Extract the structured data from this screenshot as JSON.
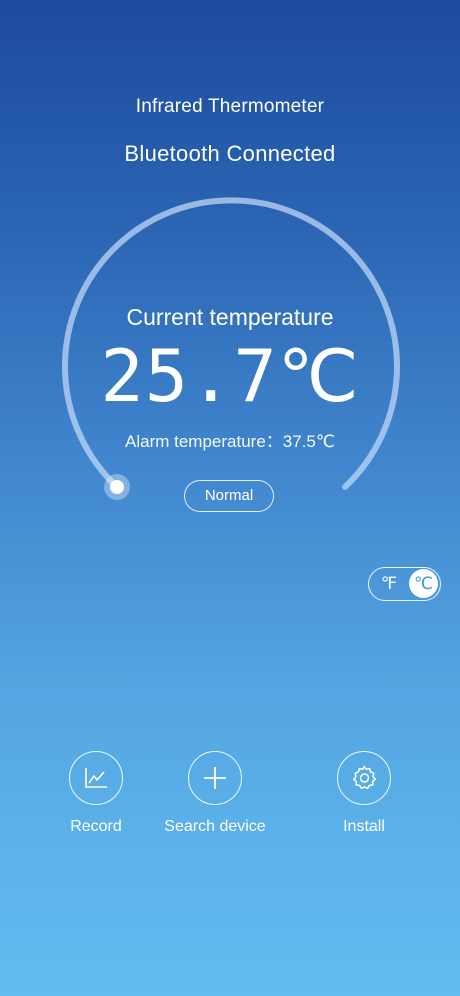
{
  "header": {
    "title": "Infrared Thermometer",
    "connection_status": "Bluetooth Connected"
  },
  "reading": {
    "label": "Current temperature",
    "value": "25.7℃",
    "alarm_text": "Alarm temperature：37.5℃",
    "status": "Normal"
  },
  "unit_toggle": {
    "fahrenheit": "℉",
    "celsius": "℃",
    "selected": "celsius"
  },
  "actions": [
    {
      "label": "Record",
      "icon": "line-chart-icon"
    },
    {
      "label": "Search device",
      "icon": "plus-icon"
    },
    {
      "label": "Install",
      "icon": "gear-icon"
    }
  ],
  "colors": {
    "background_top": "#1d4a9c",
    "background_bottom": "#62bdf0",
    "gauge_track": "#a9c9ee",
    "toggle_active_text": "#3aa0d0"
  }
}
